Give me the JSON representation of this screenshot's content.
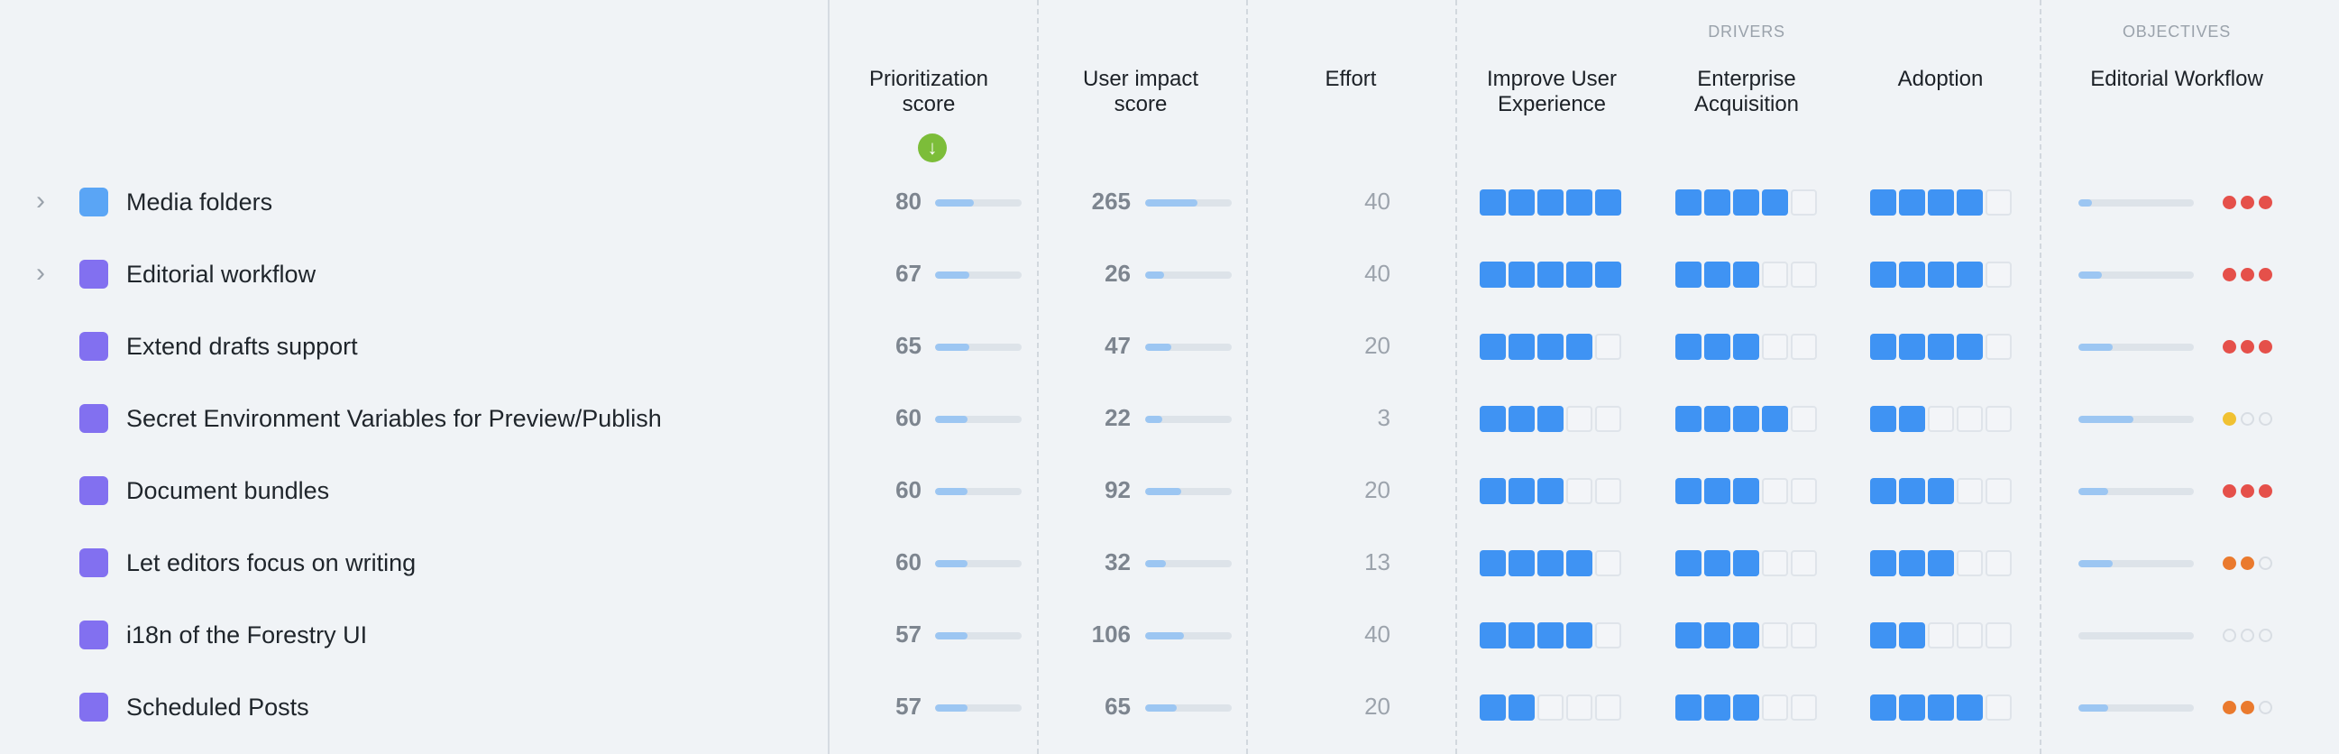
{
  "group_labels": {
    "drivers": "DRIVERS",
    "objectives": "OBJECTIVES"
  },
  "headers": {
    "prioritization_line1": "Prioritization",
    "prioritization_line2": "score",
    "impact_line1": "User impact",
    "impact_line2": "score",
    "effort": "Effort",
    "ux_line1": "Improve User",
    "ux_line2": "Experience",
    "enterprise_line1": "Enterprise",
    "enterprise_line2": "Acquisition",
    "adoption": "Adoption",
    "editorial": "Editorial Workflow"
  },
  "sort_icon": "arrow-down-circle-icon",
  "colors": {
    "blue_swatch": "#5aa5f5",
    "purple_swatch": "#8270f0",
    "score_on": "#3f93f3",
    "dot_red": "#e5504a",
    "dot_orange": "#ea7a2e",
    "dot_yellow": "#f0c132",
    "sort_green": "#7cbd39"
  },
  "rows": [
    {
      "title": "Media folders",
      "has_children": true,
      "color": "blue",
      "priority": "80",
      "priority_fill": 0.45,
      "impact": "265",
      "impact_fill": 0.6,
      "effort": "40",
      "ux": 5,
      "enterprise": 4,
      "adoption": 4,
      "objective_fill": 0.12,
      "dots": [
        "red",
        "red",
        "red"
      ]
    },
    {
      "title": "Editorial workflow",
      "has_children": true,
      "color": "purple",
      "priority": "67",
      "priority_fill": 0.4,
      "impact": "26",
      "impact_fill": 0.22,
      "effort": "40",
      "ux": 5,
      "enterprise": 3,
      "adoption": 4,
      "objective_fill": 0.2,
      "dots": [
        "red",
        "red",
        "red"
      ]
    },
    {
      "title": "Extend drafts support",
      "has_children": false,
      "color": "purple",
      "priority": "65",
      "priority_fill": 0.4,
      "impact": "47",
      "impact_fill": 0.3,
      "effort": "20",
      "ux": 4,
      "enterprise": 3,
      "adoption": 4,
      "objective_fill": 0.3,
      "dots": [
        "red",
        "red",
        "red"
      ]
    },
    {
      "title": "Secret Environment Variables for Preview/Publish",
      "has_children": false,
      "color": "purple",
      "priority": "60",
      "priority_fill": 0.38,
      "impact": "22",
      "impact_fill": 0.2,
      "effort": "3",
      "ux": 3,
      "enterprise": 4,
      "adoption": 2,
      "objective_fill": 0.48,
      "dots": [
        "yellow",
        "off",
        "off"
      ]
    },
    {
      "title": "Document bundles",
      "has_children": false,
      "color": "purple",
      "priority": "60",
      "priority_fill": 0.38,
      "impact": "92",
      "impact_fill": 0.42,
      "effort": "20",
      "ux": 3,
      "enterprise": 3,
      "adoption": 3,
      "objective_fill": 0.26,
      "dots": [
        "red",
        "red",
        "red"
      ]
    },
    {
      "title": "Let editors focus on writing",
      "has_children": false,
      "color": "purple",
      "priority": "60",
      "priority_fill": 0.38,
      "impact": "32",
      "impact_fill": 0.24,
      "effort": "13",
      "ux": 4,
      "enterprise": 3,
      "adoption": 3,
      "objective_fill": 0.3,
      "dots": [
        "orange",
        "orange",
        "off"
      ]
    },
    {
      "title": "i18n of the Forestry UI",
      "has_children": false,
      "color": "purple",
      "priority": "57",
      "priority_fill": 0.38,
      "impact": "106",
      "impact_fill": 0.45,
      "effort": "40",
      "ux": 4,
      "enterprise": 3,
      "adoption": 2,
      "objective_fill": 0,
      "dots": [
        "off",
        "off",
        "off"
      ]
    },
    {
      "title": "Scheduled Posts",
      "has_children": false,
      "color": "purple",
      "priority": "57",
      "priority_fill": 0.38,
      "impact": "65",
      "impact_fill": 0.36,
      "effort": "20",
      "ux": 2,
      "enterprise": 3,
      "adoption": 4,
      "objective_fill": 0.26,
      "dots": [
        "orange",
        "orange",
        "off"
      ]
    }
  ]
}
